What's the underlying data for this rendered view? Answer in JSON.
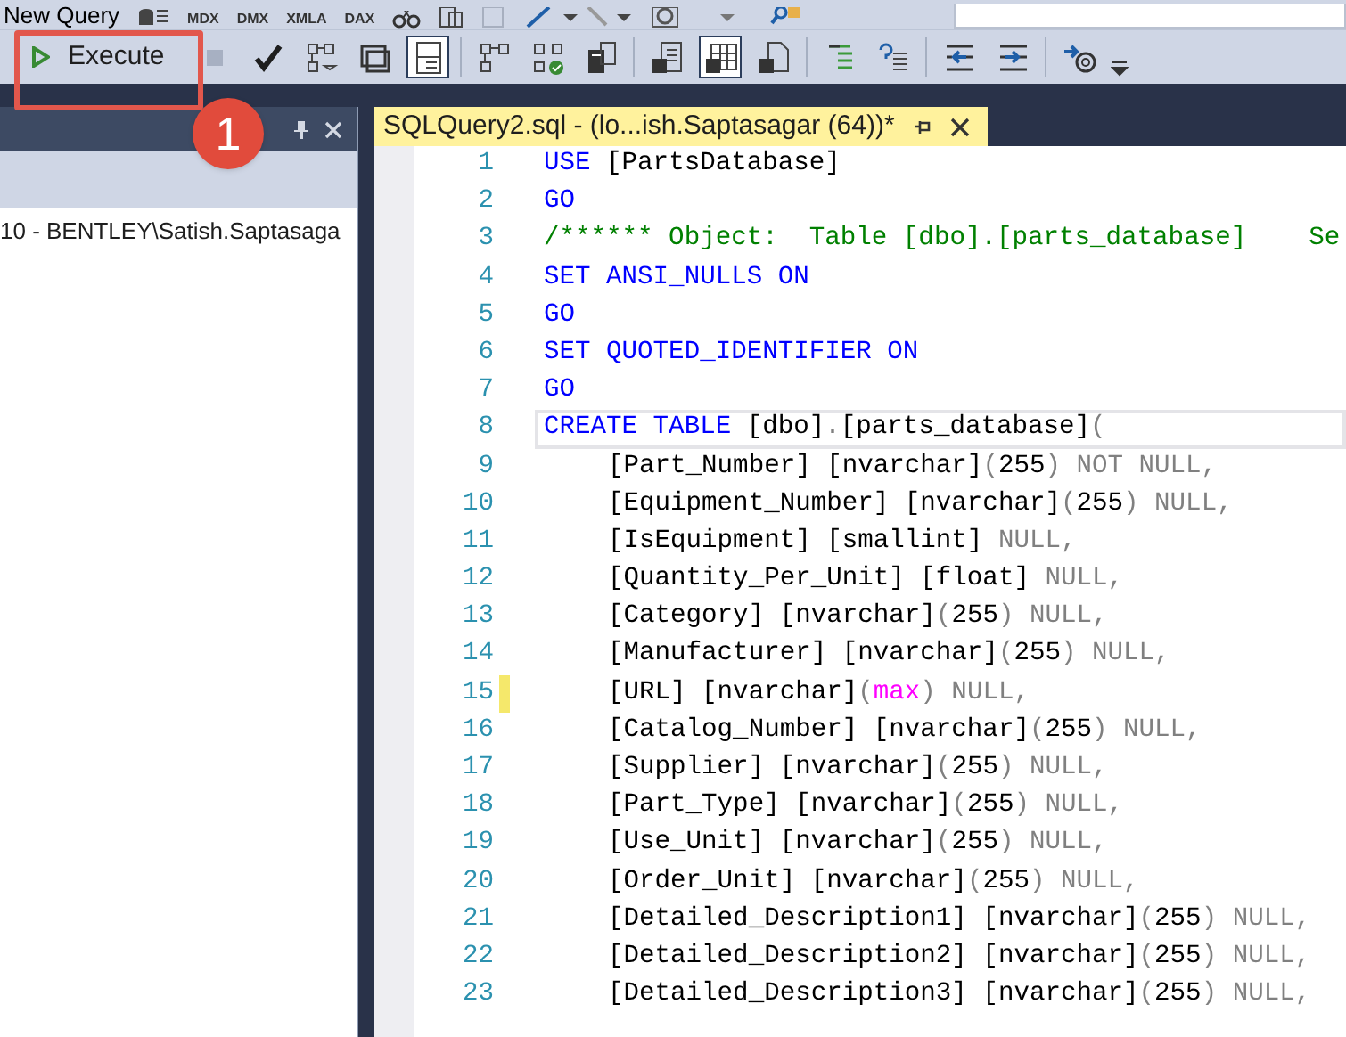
{
  "top_toolbar": {
    "new_query": "New Query",
    "query_types": [
      "MDX",
      "DMX",
      "XMLA",
      "DAX"
    ]
  },
  "toolbar": {
    "execute": {
      "label": "Execute"
    },
    "buttons": [
      {
        "pressed": false,
        "disabled": true
      },
      {
        "pressed": false,
        "disabled": false
      },
      {
        "pressed": false,
        "disabled": false
      },
      {
        "pressed": false,
        "disabled": false
      },
      {
        "pressed": true,
        "disabled": false
      },
      {
        "pressed": false,
        "disabled": false
      },
      {
        "pressed": false,
        "disabled": false
      },
      {
        "pressed": false,
        "disabled": false
      },
      {
        "pressed": false,
        "disabled": false
      },
      {
        "pressed": true,
        "disabled": false
      },
      {
        "pressed": false,
        "disabled": false
      },
      {
        "pressed": false,
        "disabled": false
      },
      {
        "pressed": false,
        "disabled": false
      },
      {
        "pressed": false,
        "disabled": false
      },
      {
        "pressed": false,
        "disabled": false
      },
      {
        "pressed": false,
        "disabled": false
      }
    ]
  },
  "annotation": {
    "label": "1"
  },
  "object_explorer": {
    "connection": "10 - BENTLEY\\Satish.Saptasaga"
  },
  "tabs": [
    {
      "title": "SQLQuery2.sql - (lo...ish.Saptasagar (64))*",
      "selected": true
    }
  ],
  "editor": {
    "lines": [
      {
        "number": "1",
        "indent": false,
        "current": false,
        "changed": false,
        "tokens": [
          {
            "kind": "keyword",
            "text": "USE"
          },
          {
            "kind": "plain",
            "text": " [PartsDatabase]"
          }
        ]
      },
      {
        "number": "2",
        "indent": false,
        "current": false,
        "changed": false,
        "tokens": [
          {
            "kind": "keyword",
            "text": "GO"
          }
        ]
      },
      {
        "number": "3",
        "indent": false,
        "current": false,
        "changed": false,
        "tokens": [
          {
            "kind": "comment",
            "text": "/****** Object:  Table [dbo].[parts_database]    Se"
          }
        ]
      },
      {
        "number": "4",
        "indent": false,
        "current": false,
        "changed": false,
        "tokens": [
          {
            "kind": "keyword",
            "text": "SET ANSI_NULLS ON"
          }
        ]
      },
      {
        "number": "5",
        "indent": false,
        "current": false,
        "changed": false,
        "tokens": [
          {
            "kind": "keyword",
            "text": "GO"
          }
        ]
      },
      {
        "number": "6",
        "indent": false,
        "current": false,
        "changed": false,
        "tokens": [
          {
            "kind": "keyword",
            "text": "SET QUOTED_IDENTIFIER ON"
          }
        ]
      },
      {
        "number": "7",
        "indent": false,
        "current": false,
        "changed": false,
        "tokens": [
          {
            "kind": "keyword",
            "text": "GO"
          }
        ]
      },
      {
        "number": "8",
        "indent": false,
        "current": true,
        "changed": false,
        "tokens": [
          {
            "kind": "keyword",
            "text": "CREATE TABLE"
          },
          {
            "kind": "plain",
            "text": " [dbo]"
          },
          {
            "kind": "operator",
            "text": "."
          },
          {
            "kind": "plain",
            "text": "[parts_database]"
          },
          {
            "kind": "operator",
            "text": "("
          }
        ]
      },
      {
        "number": "9",
        "indent": true,
        "current": false,
        "changed": false,
        "tokens": [
          {
            "kind": "plain",
            "text": "[Part_Number] [nvarchar]"
          },
          {
            "kind": "operator",
            "text": "("
          },
          {
            "kind": "plain",
            "text": "255"
          },
          {
            "kind": "operator",
            "text": ") NOT NULL,"
          }
        ]
      },
      {
        "number": "10",
        "indent": true,
        "current": false,
        "changed": false,
        "tokens": [
          {
            "kind": "plain",
            "text": "[Equipment_Number] [nvarchar]"
          },
          {
            "kind": "operator",
            "text": "("
          },
          {
            "kind": "plain",
            "text": "255"
          },
          {
            "kind": "operator",
            "text": ") NULL,"
          }
        ]
      },
      {
        "number": "11",
        "indent": true,
        "current": false,
        "changed": false,
        "tokens": [
          {
            "kind": "plain",
            "text": "[IsEquipment] [smallint]"
          },
          {
            "kind": "operator",
            "text": " NULL,"
          }
        ]
      },
      {
        "number": "12",
        "indent": true,
        "current": false,
        "changed": false,
        "tokens": [
          {
            "kind": "plain",
            "text": "[Quantity_Per_Unit] [float]"
          },
          {
            "kind": "operator",
            "text": " NULL,"
          }
        ]
      },
      {
        "number": "13",
        "indent": true,
        "current": false,
        "changed": false,
        "tokens": [
          {
            "kind": "plain",
            "text": "[Category] [nvarchar]"
          },
          {
            "kind": "operator",
            "text": "("
          },
          {
            "kind": "plain",
            "text": "255"
          },
          {
            "kind": "operator",
            "text": ") NULL,"
          }
        ]
      },
      {
        "number": "14",
        "indent": true,
        "current": false,
        "changed": false,
        "tokens": [
          {
            "kind": "plain",
            "text": "[Manufacturer] [nvarchar]"
          },
          {
            "kind": "operator",
            "text": "("
          },
          {
            "kind": "plain",
            "text": "255"
          },
          {
            "kind": "operator",
            "text": ") NULL,"
          }
        ]
      },
      {
        "number": "15",
        "indent": true,
        "current": false,
        "changed": true,
        "tokens": [
          {
            "kind": "plain",
            "text": "[URL] [nvarchar]"
          },
          {
            "kind": "operator",
            "text": "("
          },
          {
            "kind": "function",
            "text": "max"
          },
          {
            "kind": "operator",
            "text": ") NULL,"
          }
        ]
      },
      {
        "number": "16",
        "indent": true,
        "current": false,
        "changed": false,
        "tokens": [
          {
            "kind": "plain",
            "text": "[Catalog_Number] [nvarchar]"
          },
          {
            "kind": "operator",
            "text": "("
          },
          {
            "kind": "plain",
            "text": "255"
          },
          {
            "kind": "operator",
            "text": ") NULL,"
          }
        ]
      },
      {
        "number": "17",
        "indent": true,
        "current": false,
        "changed": false,
        "tokens": [
          {
            "kind": "plain",
            "text": "[Supplier] [nvarchar]"
          },
          {
            "kind": "operator",
            "text": "("
          },
          {
            "kind": "plain",
            "text": "255"
          },
          {
            "kind": "operator",
            "text": ") NULL,"
          }
        ]
      },
      {
        "number": "18",
        "indent": true,
        "current": false,
        "changed": false,
        "tokens": [
          {
            "kind": "plain",
            "text": "[Part_Type] [nvarchar]"
          },
          {
            "kind": "operator",
            "text": "("
          },
          {
            "kind": "plain",
            "text": "255"
          },
          {
            "kind": "operator",
            "text": ") NULL,"
          }
        ]
      },
      {
        "number": "19",
        "indent": true,
        "current": false,
        "changed": false,
        "tokens": [
          {
            "kind": "plain",
            "text": "[Use_Unit] [nvarchar]"
          },
          {
            "kind": "operator",
            "text": "("
          },
          {
            "kind": "plain",
            "text": "255"
          },
          {
            "kind": "operator",
            "text": ") NULL,"
          }
        ]
      },
      {
        "number": "20",
        "indent": true,
        "current": false,
        "changed": false,
        "tokens": [
          {
            "kind": "plain",
            "text": "[Order_Unit] [nvarchar]"
          },
          {
            "kind": "operator",
            "text": "("
          },
          {
            "kind": "plain",
            "text": "255"
          },
          {
            "kind": "operator",
            "text": ") NULL,"
          }
        ]
      },
      {
        "number": "21",
        "indent": true,
        "current": false,
        "changed": false,
        "tokens": [
          {
            "kind": "plain",
            "text": "[Detailed_Description1] [nvarchar]"
          },
          {
            "kind": "operator",
            "text": "("
          },
          {
            "kind": "plain",
            "text": "255"
          },
          {
            "kind": "operator",
            "text": ") NULL,"
          }
        ]
      },
      {
        "number": "22",
        "indent": true,
        "current": false,
        "changed": false,
        "tokens": [
          {
            "kind": "plain",
            "text": "[Detailed_Description2] [nvarchar]"
          },
          {
            "kind": "operator",
            "text": "("
          },
          {
            "kind": "plain",
            "text": "255"
          },
          {
            "kind": "operator",
            "text": ") NULL,"
          }
        ]
      },
      {
        "number": "23",
        "indent": true,
        "current": false,
        "changed": false,
        "tokens": [
          {
            "kind": "plain",
            "text": "[Detailed_Description3] [nvarchar]"
          },
          {
            "kind": "operator",
            "text": "("
          },
          {
            "kind": "plain",
            "text": "255"
          },
          {
            "kind": "operator",
            "text": ") NULL,"
          }
        ]
      }
    ]
  }
}
